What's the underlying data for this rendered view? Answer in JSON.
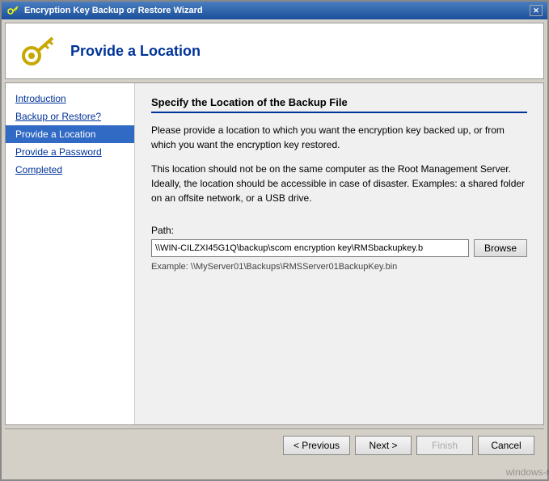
{
  "window": {
    "title": "Encryption Key Backup or Restore Wizard",
    "close_label": "✕"
  },
  "header": {
    "title": "Provide a Location",
    "icon_alt": "key-icon"
  },
  "sidebar": {
    "items": [
      {
        "label": "Introduction",
        "active": false
      },
      {
        "label": "Backup or Restore?",
        "active": false
      },
      {
        "label": "Provide a Location",
        "active": true
      },
      {
        "label": "Provide a Password",
        "active": false
      },
      {
        "label": "Completed",
        "active": false
      }
    ]
  },
  "main": {
    "section_title": "Specify the Location of the Backup File",
    "description1": "Please provide a location to which you want the encryption key backed up, or from which you want the encryption key restored.",
    "description2": "This location should not be on the same computer as the Root Management Server. Ideally, the location should be accessible in case of disaster. Examples: a shared folder on an offsite network, or a USB drive.",
    "path_label": "Path:",
    "path_value": "\\\\WIN-CILZXI45G1Q\\backup\\scom encryption key\\RMSbackupkey.b",
    "path_placeholder": "",
    "browse_label": "Browse",
    "example_text": "Example: \\\\MyServer01\\Backups\\RMSServer01BackupKey.bin"
  },
  "footer": {
    "previous_label": "< Previous",
    "next_label": "Next >",
    "finish_label": "Finish",
    "cancel_label": "Cancel"
  },
  "watermark": "windows-noob.com"
}
